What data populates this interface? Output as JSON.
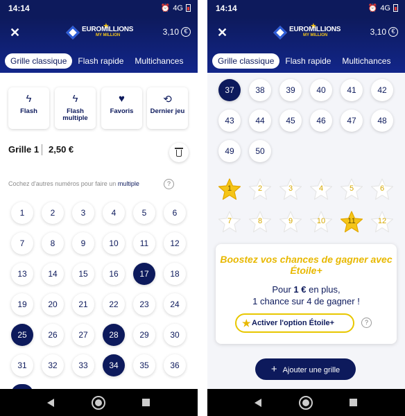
{
  "status": {
    "time": "14:14",
    "network": "4G"
  },
  "appbar": {
    "close": "✕",
    "logo_text": "EUROMILLIONS",
    "logo_sub": "MY MILLION",
    "price": "3,10",
    "currency": "€"
  },
  "tabs": [
    "Grille classique",
    "Flash rapide",
    "Multichances"
  ],
  "tools": [
    {
      "icon": "flash-icon",
      "glyph": "ϟ",
      "label": "Flash"
    },
    {
      "icon": "multi-flash-icon",
      "glyph": "ϟ",
      "label": "Flash multiple"
    },
    {
      "icon": "heart-icon",
      "glyph": "♥",
      "label": "Favoris"
    },
    {
      "icon": "history-icon",
      "glyph": "⟲",
      "label": "Dernier jeu"
    }
  ],
  "grille": {
    "title": "Grille 1",
    "price": "2,50 €"
  },
  "hint": {
    "text": "Cochez d'autres numéros pour faire un ",
    "link": "multiple",
    "help": "?"
  },
  "left_numbers": [
    1,
    2,
    3,
    4,
    5,
    6,
    7,
    8,
    9,
    10,
    11,
    12,
    13,
    14,
    15,
    16,
    17,
    18,
    19,
    20,
    21,
    22,
    23,
    24,
    25,
    26,
    27,
    28,
    29,
    30,
    31,
    32,
    33,
    34,
    35,
    36
  ],
  "left_selected": [
    17,
    25,
    28,
    34
  ],
  "right_numbers": [
    37,
    38,
    39,
    40,
    41,
    42,
    43,
    44,
    45,
    46,
    47,
    48,
    49,
    50
  ],
  "right_selected": [
    37
  ],
  "stars": [
    1,
    2,
    3,
    4,
    5,
    6,
    7,
    8,
    9,
    10,
    11,
    12
  ],
  "stars_selected": [
    1,
    11
  ],
  "promo": {
    "title": "Boostez vos chances de gagner avec Étoile+",
    "line1_prefix": "Pour ",
    "line1_bold": "1 €",
    "line1_suffix": " en plus,",
    "line2": "1 chance sur 4 de gagner !",
    "button": "Activer l'option Étoile+",
    "help": "?"
  },
  "add_button": {
    "plus": "+",
    "label": "Ajouter une grille"
  },
  "colors": {
    "navy": "#0d1a5c",
    "gold": "#f5c518",
    "accent_gold": "#e8b800"
  }
}
